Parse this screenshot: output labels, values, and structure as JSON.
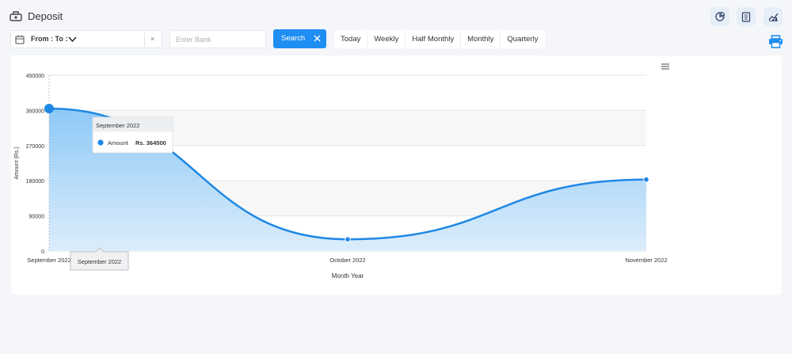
{
  "header": {
    "title": "Deposit",
    "icons": [
      "deposit-icon",
      "pie-chart-icon",
      "report-icon",
      "line-chart-icon"
    ]
  },
  "filters": {
    "date_label": "From : To :",
    "date_clear": "×",
    "bank_placeholder": "Enter Bank",
    "search_label": "Search",
    "ranges": [
      "Today",
      "Weekly",
      "Half Monthly",
      "Monthly",
      "Quarterly"
    ]
  },
  "print": {
    "icon": "printer-icon"
  },
  "chart_menu": {
    "icon": "hamburger-icon"
  },
  "chart_data": {
    "type": "area",
    "categories": [
      "September 2022",
      "October 2022",
      "November 2022"
    ],
    "series": [
      {
        "name": "Amount",
        "values": [
          364500,
          30000,
          183000
        ]
      }
    ],
    "ylabel": "Amount (Rs.)",
    "xlabel": "Month Year",
    "ylim": [
      0,
      450000
    ],
    "yticks": [
      0,
      90000,
      180000,
      270000,
      360000,
      450000
    ],
    "colors": {
      "line": "#1e88e5",
      "fill_top": "#8ec9f7",
      "fill_bottom": "#dcedfb",
      "band": "#f7f7f7"
    },
    "tooltip": {
      "title": "September 2022",
      "series": "Amount",
      "value": "Rs. 364500"
    },
    "crosshair_label": "September 2022"
  }
}
